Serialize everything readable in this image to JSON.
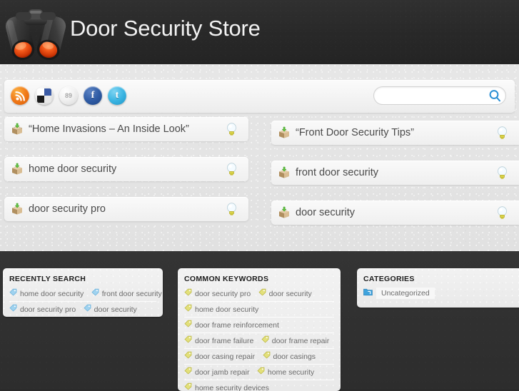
{
  "header": {
    "site_title": "Door Security Store",
    "logo_icon": "binoculars-icon"
  },
  "toolbar": {
    "social_icons": [
      {
        "name": "rss-icon",
        "label": "RSS",
        "glyph": ""
      },
      {
        "name": "delicious-icon",
        "label": "Delicious",
        "glyph": ""
      },
      {
        "name": "digg-icon",
        "label": "Digg",
        "glyph": "89"
      },
      {
        "name": "facebook-icon",
        "label": "Facebook",
        "glyph": "f"
      },
      {
        "name": "twitter-icon",
        "label": "Twitter",
        "glyph": "t"
      }
    ],
    "search": {
      "value": "",
      "placeholder": "",
      "button_icon": "search-icon",
      "accent_color": "#2a8fd4"
    }
  },
  "results": {
    "left_column": [
      {
        "icon": "package-icon",
        "label": "“Home Invasions – An Inside Look”",
        "action_icon": "lightbulb-icon"
      },
      {
        "icon": "package-icon",
        "label": "home door security",
        "action_icon": "lightbulb-icon"
      },
      {
        "icon": "package-icon",
        "label": "door security pro",
        "action_icon": "lightbulb-icon"
      }
    ],
    "right_column": [
      {
        "icon": "package-icon",
        "label": "“Front Door Security Tips”",
        "action_icon": "lightbulb-icon"
      },
      {
        "icon": "package-icon",
        "label": "front door security",
        "action_icon": "lightbulb-icon"
      },
      {
        "icon": "package-icon",
        "label": "door security",
        "action_icon": "lightbulb-icon"
      }
    ]
  },
  "footer": {
    "recently_search": {
      "title": "RECENTLY SEARCH",
      "tag_icon": "tag-icon-blue",
      "lines": [
        [
          "home door security",
          "front door security"
        ],
        [
          "door security pro",
          "door security"
        ]
      ]
    },
    "common_keywords": {
      "title": "COMMON KEYWORDS",
      "tag_icon": "tag-icon-yellow",
      "lines": [
        [
          "door security pro",
          "door security"
        ],
        [
          "home door security"
        ],
        [
          "door frame reinforcement"
        ],
        [
          "door frame failure",
          "door frame repair"
        ],
        [
          "door casing repair",
          "door casings"
        ],
        [
          "door jamb repair",
          "home security"
        ],
        [
          "home security devices"
        ]
      ]
    },
    "categories": {
      "title": "CATEGORIES",
      "folder_icon": "folder-icon",
      "items": [
        "Uncategorized"
      ]
    }
  },
  "colors": {
    "header_bg": "#2a2a2a",
    "content_bg": "#e3e3e3",
    "footer_bg": "#2f2f2f",
    "panel_bg": "#ececec",
    "text_dark": "#4a4a4a",
    "link_gray": "#6b6b6b"
  }
}
